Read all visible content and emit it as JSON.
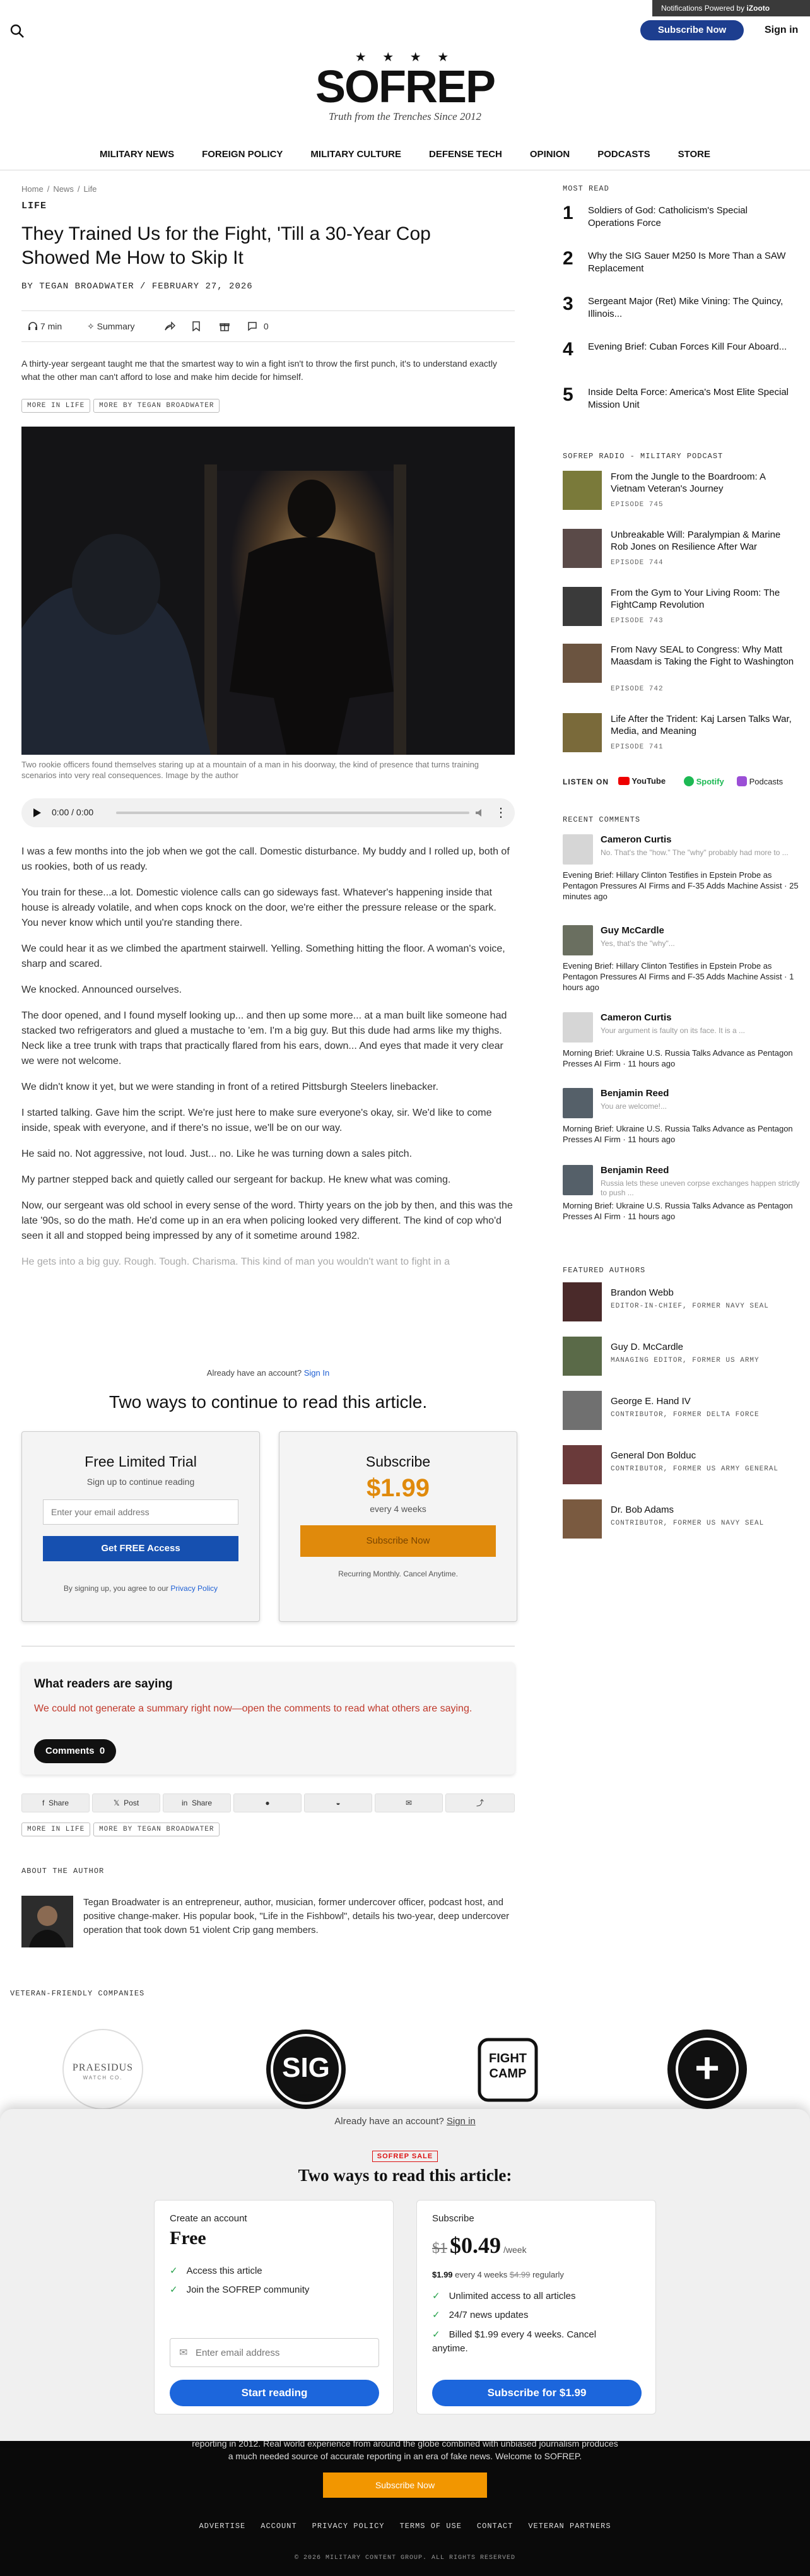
{
  "notification": {
    "text": "Notifications Powered by",
    "brand": "iZooto"
  },
  "header": {
    "subscribe_label": "Subscribe Now",
    "signin_label": "Sign in",
    "logo_stars": "★ ★ ★ ★",
    "logo_word": "SOFREP",
    "tagline": "Truth from the Trenches Since 2012",
    "nav": [
      "MILITARY NEWS",
      "FOREIGN POLICY",
      "MILITARY CULTURE",
      "DEFENSE TECH",
      "OPINION",
      "PODCASTS",
      "STORE"
    ]
  },
  "article": {
    "breadcrumb": [
      "Home",
      "/",
      "News",
      "/",
      "Life"
    ],
    "section": "LIFE",
    "title": "They Trained Us for the Fight, 'Till a 30-Year Cop Showed Me How to Skip It",
    "byline": "BY TEGAN BROADWATER / FEBRUARY 27, 2026",
    "toolbar": {
      "read_time": "7 min",
      "summary": "Summary",
      "comments": "0"
    },
    "dek": "A thirty-year sergeant taught me that the smartest way to win a fight isn't to throw the first punch, it's to understand exactly what the other man can't afford to lose and make him decide for himself.",
    "tags": [
      "MORE IN LIFE",
      "MORE BY TEGAN BROADWATER"
    ],
    "caption": "Two rookie officers found themselves staring up at a mountain of a man in his doorway, the kind of presence that turns training scenarios into very real consequences. Image by the author",
    "audio_time": "0:00 / 0:00",
    "paragraphs": [
      "I was a few months into the job when we got the call. Domestic disturbance. My buddy and I rolled up, both of us rookies, both of us ready.",
      "You train for these...a lot. Domestic violence calls can go sideways fast. Whatever's happening inside that house is already volatile, and when cops knock on the door, we're either the pressure release or the spark. You never know which until you're standing there.",
      "We could hear it as we climbed the apartment stairwell. Yelling. Something hitting the floor. A woman's voice, sharp and scared.",
      "We knocked. Announced ourselves.",
      "The door opened, and I found myself looking up... and then up some more... at a man built like someone had stacked two refrigerators and glued a mustache to 'em. I'm a big guy. But this dude had arms like my thighs. Neck like a tree trunk with traps that practically flared from his ears, down... And eyes that made it very clear we were not welcome.",
      "We didn't know it yet, but we were standing in front of a retired Pittsburgh Steelers linebacker.",
      "I started talking. Gave him the script. We're just here to make sure everyone's okay, sir. We'd like to come inside, speak with everyone, and if there's no issue, we'll be on our way.",
      "He said no. Not aggressive, not loud. Just... no. Like he was turning down a sales pitch.",
      "My partner stepped back and quietly called our sergeant for backup. He knew what was coming.",
      "Now, our sergeant was old school in every sense of the word. Thirty years on the job by then, and this was the late '90s, so do the math. He'd come up in an era when policing looked very different. The kind of cop who'd seen it all and stopped being impressed by any of it sometime around 1982.",
      "He gets into a big guy. Rough. Tough. Charisma. This kind of man you wouldn't want to fight in a"
    ]
  },
  "paywall": {
    "already": "Already have an account?",
    "signin": "Sign In",
    "title": "Two ways to continue to read this article.",
    "trial": {
      "title": "Free Limited Trial",
      "sub": "Sign up to continue reading",
      "placeholder": "Enter your email address",
      "button": "Get FREE Access",
      "terms": "By signing up, you agree to our",
      "privacy": "Privacy Policy"
    },
    "subscribe": {
      "title": "Subscribe",
      "price": "$1.99",
      "period": "every 4 weeks",
      "button": "Subscribe Now",
      "note": "Recurring Monthly. Cancel Anytime."
    }
  },
  "readers": {
    "title": "What readers are saying",
    "error": "We could not generate a summary right now—open the comments to read what others are saying.",
    "comments_label": "Comments",
    "comments_count": "0"
  },
  "share": {
    "facebook": "Share",
    "x": "Post",
    "linkedin": "Share"
  },
  "about": {
    "heading": "ABOUT THE AUTHOR",
    "bio": "Tegan Broadwater is an entrepreneur, author, musician, former undercover officer, podcast host, and positive change-maker. His popular book, \"Life in the Fishbowl\", details his two-year, deep undercover operation that took down 51 violent Crip gang members."
  },
  "veteran": {
    "heading": "VETERAN-FRIENDLY COMPANIES",
    "logos": [
      "PRAESIDUS",
      "SIG",
      "FIGHT CAMP",
      "+"
    ],
    "praesidus_sub": "WATCH CO."
  },
  "sidebar": {
    "most_read_heading": "MOST READ",
    "most_read": [
      {
        "num": "1",
        "title": "Soldiers of God: Catholicism's Special Operations Force"
      },
      {
        "num": "2",
        "title": "Why the SIG Sauer M250 Is More Than a SAW Replacement"
      },
      {
        "num": "3",
        "title": "Sergeant Major (Ret) Mike Vining: The Quincy, Illinois..."
      },
      {
        "num": "4",
        "title": "Evening Brief: Cuban Forces Kill Four Aboard..."
      },
      {
        "num": "5",
        "title": "Inside Delta Force: America's Most Elite Special Mission Unit"
      }
    ],
    "podcast_heading": "SOFREP RADIO - MILITARY PODCAST",
    "podcasts": [
      {
        "title": "From the Jungle to the Boardroom: A Vietnam Veteran's Journey",
        "ep": "EPISODE 745"
      },
      {
        "title": "Unbreakable Will: Paralympian & Marine Rob Jones on Resilience After War",
        "ep": "EPISODE 744"
      },
      {
        "title": "From the Gym to Your Living Room: The FightCamp Revolution",
        "ep": "EPISODE 743"
      },
      {
        "title": "From Navy SEAL to Congress: Why Matt Maasdam is Taking the Fight to Washington",
        "ep": "EPISODE 742"
      },
      {
        "title": "Life After the Trident: Kaj Larsen Talks War, Media, and Meaning",
        "ep": "EPISODE 741"
      }
    ],
    "listen_on": "LISTEN ON",
    "platforms": [
      "YouTube",
      "Spotify",
      "Podcasts"
    ],
    "comments_heading": "RECENT COMMENTS",
    "comments": [
      {
        "name": "Cameron Curtis",
        "snippet": "No. That's the \"how.\" The \"why\" probably had more to ...",
        "ref": "Evening Brief: Hillary Clinton Testifies in Epstein Probe as Pentagon Pressures AI Firms and F-35 Adds Machine Assist · 25 minutes ago"
      },
      {
        "name": "Guy McCardle",
        "snippet": "Yes, that's the \"why\"...",
        "ref": "Evening Brief: Hillary Clinton Testifies in Epstein Probe as Pentagon Pressures AI Firms and F-35 Adds Machine Assist · 1 hours ago"
      },
      {
        "name": "Cameron Curtis",
        "snippet": "Your argument is faulty on its face. It is a ...",
        "ref": "Morning Brief: Ukraine U.S. Russia Talks Advance as Pentagon Presses AI Firm · 11 hours ago"
      },
      {
        "name": "Benjamin Reed",
        "snippet": "You are welcome!...",
        "ref": "Morning Brief: Ukraine U.S. Russia Talks Advance as Pentagon Presses AI Firm · 11 hours ago"
      },
      {
        "name": "Benjamin Reed",
        "snippet": "Russia lets these uneven corpse exchanges happen strictly to push ...",
        "ref": "Morning Brief: Ukraine U.S. Russia Talks Advance as Pentagon Presses AI Firm · 11 hours ago"
      }
    ],
    "authors_heading": "FEATURED AUTHORS",
    "authors": [
      {
        "name": "Brandon Webb",
        "role": "EDITOR-IN-CHIEF, FORMER NAVY SEAL"
      },
      {
        "name": "Guy D. McCardle",
        "role": "MANAGING EDITOR, FORMER US ARMY"
      },
      {
        "name": "George E. Hand IV",
        "role": "CONTRIBUTOR, FORMER DELTA FORCE"
      },
      {
        "name": "General Don Bolduc",
        "role": "CONTRIBUTOR, FORMER US ARMY GENERAL"
      },
      {
        "name": "Dr. Bob Adams",
        "role": "CONTRIBUTOR, FORMER US NAVY SEAL"
      }
    ]
  },
  "overlay": {
    "already": "Already have an account?",
    "signin": "Sign in",
    "sale": "SOFREP SALE",
    "title": "Two ways to read this article:",
    "free": {
      "label": "Create an account",
      "price": "Free",
      "features": [
        "Access this article",
        "Join the SOFREP community"
      ],
      "placeholder": "Enter email address",
      "button": "Start reading"
    },
    "sub": {
      "label": "Subscribe",
      "old_price": "$1",
      "price": "$0.49",
      "per": "/week",
      "billing_price": "$1.99",
      "billing_text": "every 4 weeks",
      "regular_price": "$4.99",
      "regular_text": "regularly",
      "features": [
        "Unlimited access to all articles",
        "24/7 news updates",
        "Billed $1.99 every 4 weeks. Cancel anytime."
      ],
      "button": "Subscribe for $1.99"
    }
  },
  "footer": {
    "text": "reporting in 2012. Real world experience from around the globe combined with unbiased journalism produces a much needed source of accurate reporting in an era of fake news. Welcome to SOFREP.",
    "button": "Subscribe Now",
    "links": [
      "ADVERTISE",
      "ACCOUNT",
      "PRIVACY POLICY",
      "TERMS OF USE",
      "CONTACT",
      "VETERAN PARTNERS"
    ],
    "copyright": "© 2026 MILITARY CONTENT GROUP. ALL RIGHTS RESERVED"
  },
  "colors": {
    "brand_blue": "#1d3e8f",
    "accent_orange": "#e08a0c",
    "cta_blue": "#1c66dc",
    "error_red": "#c0392b"
  }
}
